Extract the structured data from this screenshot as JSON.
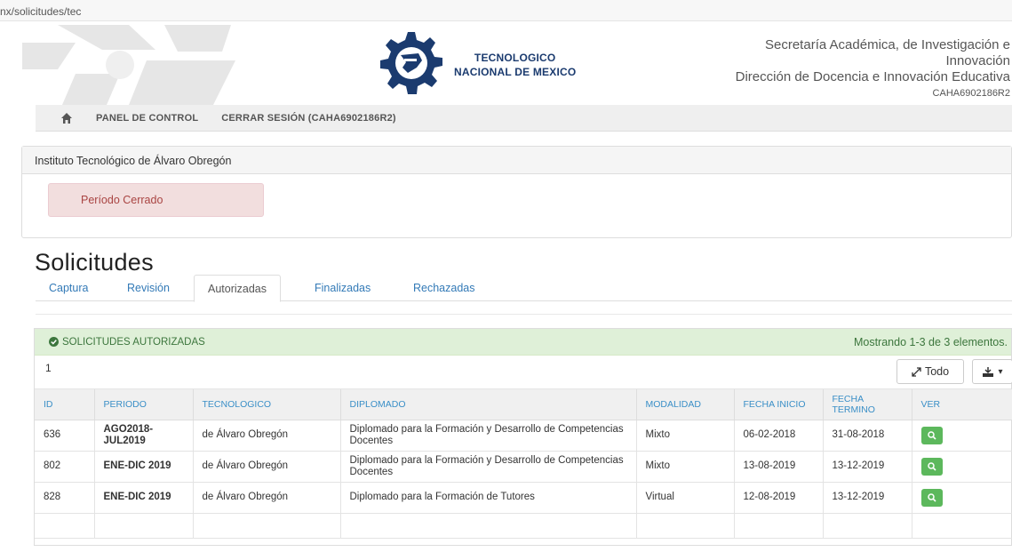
{
  "browser": {
    "url": "nx/solicitudes/tec"
  },
  "header": {
    "logo_line1": "TECNOLOGICO",
    "logo_line2": "NACIONAL DE MEXICO",
    "sec_line1": "Secretaría Académica, de Investigación e",
    "sec_line2": "Innovación",
    "sec_line3": "Dirección de Docencia e Innovación Educativa",
    "user_id": "CAHA6902186R2"
  },
  "navbar": {
    "home_icon": "home-icon",
    "panel_label": "PANEL DE CONTROL",
    "logout_label": "CERRAR SESIÓN (CAHA6902186R2)"
  },
  "institute": {
    "name": "Instituto Tecnológico de Álvaro Obregón",
    "status": "Período Cerrado"
  },
  "page": {
    "title": "Solicitudes"
  },
  "tabs": [
    {
      "label": "Captura"
    },
    {
      "label": "Revisión"
    },
    {
      "label": "Autorizadas"
    },
    {
      "label": "Finalizadas"
    },
    {
      "label": "Rechazadas"
    }
  ],
  "grid": {
    "heading": "SOLICITUDES AUTORIZADAS",
    "summary": "Mostrando 1-3 de 3 elementos.",
    "page_count": "1",
    "todo_label": "Todo",
    "columns": {
      "id": "ID",
      "periodo": "PERIODO",
      "tecnologico": "TECNOLOGICO",
      "diplomado": "DIPLOMADO",
      "modalidad": "MODALIDAD",
      "fecha_inicio": "FECHA INICIO",
      "fecha_termino": "FECHA TERMINO",
      "ver": "VER"
    },
    "rows": [
      {
        "id": "636",
        "periodo": "AGO2018-JUL2019",
        "tecnologico": "de Álvaro Obregón",
        "diplomado": "Diplomado para la Formación y Desarrollo de Competencias Docentes",
        "modalidad": "Mixto",
        "fecha_inicio": "06-02-2018",
        "fecha_termino": "31-08-2018"
      },
      {
        "id": "802",
        "periodo": "ENE-DIC 2019",
        "tecnologico": "de Álvaro Obregón",
        "diplomado": "Diplomado para la Formación y Desarrollo de Competencias Docentes",
        "modalidad": "Mixto",
        "fecha_inicio": "13-08-2019",
        "fecha_termino": "13-12-2019"
      },
      {
        "id": "828",
        "periodo": "ENE-DIC 2019",
        "tecnologico": "de Álvaro Obregón",
        "diplomado": "Diplomado para la Formación de Tutores",
        "modalidad": "Virtual",
        "fecha_inicio": "12-08-2019",
        "fecha_termino": "13-12-2019"
      }
    ]
  },
  "colors": {
    "success_bg": "#dff0d8",
    "success_text": "#3c763d",
    "danger_bg": "#f2dede",
    "danger_text": "#a94442",
    "link": "#337ab7",
    "view_button": "#5cb85c"
  }
}
